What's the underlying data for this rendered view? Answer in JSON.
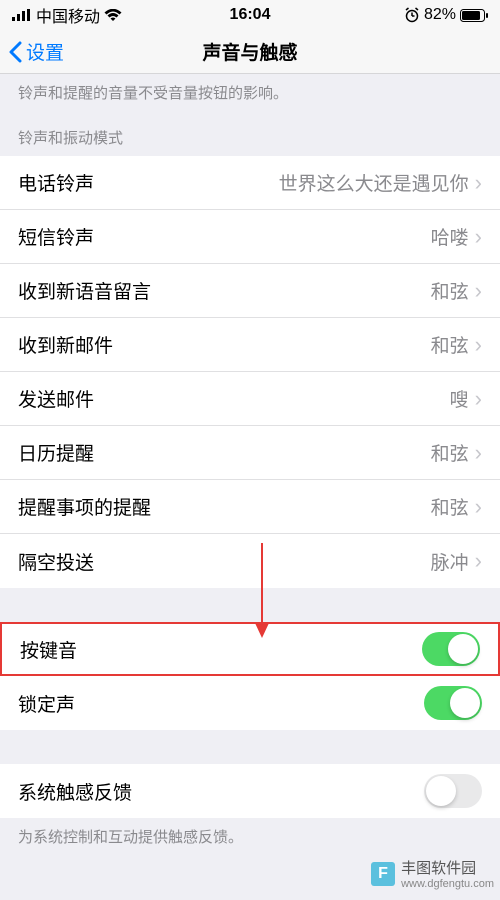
{
  "status_bar": {
    "carrier": "中国移动",
    "time": "16:04",
    "battery_percent": "82%"
  },
  "nav": {
    "back_label": "设置",
    "title": "声音与触感"
  },
  "top_footer": "铃声和提醒的音量不受音量按钮的影响。",
  "section1_header": "铃声和振动模式",
  "rows": [
    {
      "label": "电话铃声",
      "value": "世界这么大还是遇见你"
    },
    {
      "label": "短信铃声",
      "value": "哈喽"
    },
    {
      "label": "收到新语音留言",
      "value": "和弦"
    },
    {
      "label": "收到新邮件",
      "value": "和弦"
    },
    {
      "label": "发送邮件",
      "value": "嗖"
    },
    {
      "label": "日历提醒",
      "value": "和弦"
    },
    {
      "label": "提醒事项的提醒",
      "value": "和弦"
    },
    {
      "label": "隔空投送",
      "value": "脉冲"
    }
  ],
  "toggles": {
    "keyboard_clicks": {
      "label": "按键音",
      "on": true
    },
    "lock_sound": {
      "label": "锁定声",
      "on": true
    }
  },
  "haptics": {
    "label": "系统触感反馈",
    "on": false,
    "footer": "为系统控制和互动提供触感反馈。"
  },
  "watermark": {
    "name": "丰图软件园",
    "url": "www.dgfengtu.com"
  }
}
